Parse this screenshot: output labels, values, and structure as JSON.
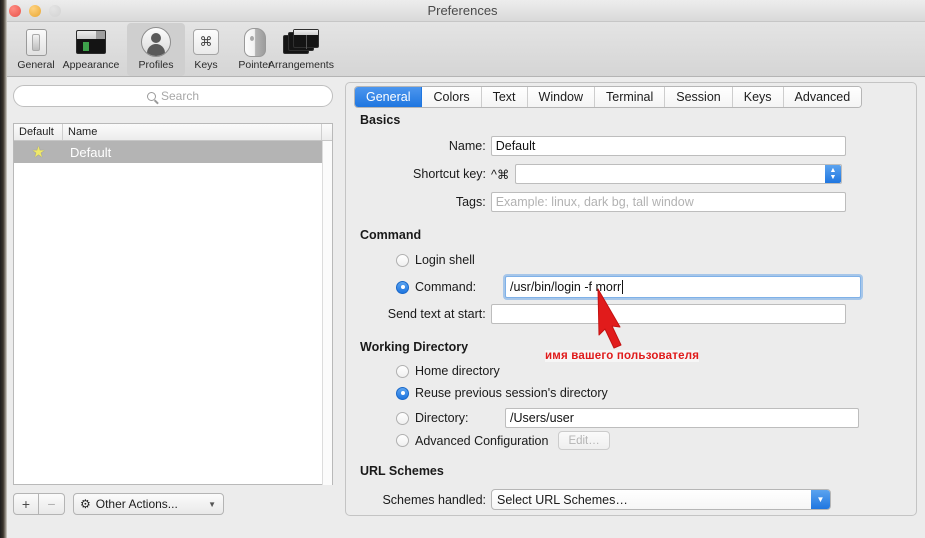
{
  "window": {
    "title": "Preferences",
    "traffic_lights": [
      "close-red",
      "minimize-yellow",
      "zoom-disabled"
    ]
  },
  "toolbar": {
    "items": [
      {
        "label": "General",
        "icon": "toggle-switch-icon",
        "selected": false
      },
      {
        "label": "Appearance",
        "icon": "window-appearance-icon",
        "selected": false
      },
      {
        "label": "Profiles",
        "icon": "person-silhouette-icon",
        "selected": true
      },
      {
        "label": "Keys",
        "icon": "command-key-icon",
        "selected": false
      },
      {
        "label": "Pointer",
        "icon": "mouse-icon",
        "selected": false
      },
      {
        "label": "Arrangements",
        "icon": "stacked-windows-icon",
        "selected": false
      }
    ]
  },
  "sidebar": {
    "search": {
      "placeholder": "Search",
      "value": "",
      "icon": "search-icon"
    },
    "columns": [
      "Default",
      "Name"
    ],
    "rows": [
      {
        "star": "★",
        "name": "Default",
        "selected": true
      }
    ],
    "footer": {
      "add_label": "+",
      "remove_label": "−",
      "other_actions_label": "Other Actions...",
      "gear_icon": "gear-icon",
      "chevron_icon": "chevron-down-icon"
    }
  },
  "tabs": [
    {
      "label": "General",
      "active": true
    },
    {
      "label": "Colors",
      "active": false
    },
    {
      "label": "Text",
      "active": false
    },
    {
      "label": "Window",
      "active": false
    },
    {
      "label": "Terminal",
      "active": false
    },
    {
      "label": "Session",
      "active": false
    },
    {
      "label": "Keys",
      "active": false
    },
    {
      "label": "Advanced",
      "active": false
    }
  ],
  "basics": {
    "title": "Basics",
    "name_label": "Name:",
    "name_value": "Default",
    "shortcut_label": "Shortcut key:",
    "shortcut_prefix": "^⌘",
    "shortcut_value": "",
    "tags_label": "Tags:",
    "tags_value": "",
    "tags_placeholder": "Example: linux, dark bg, tall window"
  },
  "command": {
    "title": "Command",
    "login_shell_label": "Login shell",
    "login_shell_selected": false,
    "command_label": "Command:",
    "command_selected": true,
    "command_value": "/usr/bin/login -f morr",
    "send_text_label": "Send text at start:",
    "send_text_value": ""
  },
  "working_directory": {
    "title": "Working Directory",
    "home_label": "Home directory",
    "home_selected": false,
    "reuse_label": "Reuse previous session's directory",
    "reuse_selected": true,
    "directory_label": "Directory:",
    "directory_selected": false,
    "directory_value": "/Users/user",
    "advanced_label": "Advanced Configuration",
    "advanced_selected": false,
    "edit_button_label": "Edit…"
  },
  "url_schemes": {
    "title": "URL Schemes",
    "schemes_label": "Schemes handled:",
    "schemes_value": "Select URL Schemes…",
    "chevron_icon": "chevron-down-icon"
  },
  "annotation": {
    "text": "имя вашего пользователя",
    "color": "#e01b1b",
    "arrow_icon": "red-arrow-icon"
  },
  "colors": {
    "accent_blue": "#1f76e0",
    "selection_gray": "#b4b4b4",
    "star_yellow": "#efe96a",
    "annotation_red": "#e01b1b"
  }
}
